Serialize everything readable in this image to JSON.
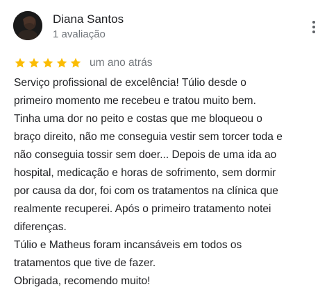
{
  "reviewer": {
    "name": "Diana Santos",
    "review_count": "1 avaliação"
  },
  "icons": {
    "avatar": "profile-photo",
    "menu": "more-vert-icon",
    "star": "star-icon"
  },
  "rating": {
    "stars": 5,
    "max": 5,
    "star_color": "#fbbc04",
    "date": "um ano atrás"
  },
  "review_lines": [
    "Serviço profissional de excelência! Túlio desde o",
    "primeiro momento me recebeu e tratou muito bem.",
    "Tinha uma dor no peito e costas que me bloqueou o",
    "braço direito, não me conseguia vestir sem torcer toda e",
    "não conseguia tossir sem doer... Depois de uma ida ao",
    "hospital, medicação e horas de sofrimento, sem dormir",
    "por causa da dor, foi com os tratamentos na clínica que",
    "realmente recuperei. Após o primeiro tratamento notei",
    "diferenças.",
    "Túlio e Matheus foram incansáveis em todos os",
    "tratamentos que tive de fazer.",
    "Obrigada, recomendo muito!"
  ]
}
